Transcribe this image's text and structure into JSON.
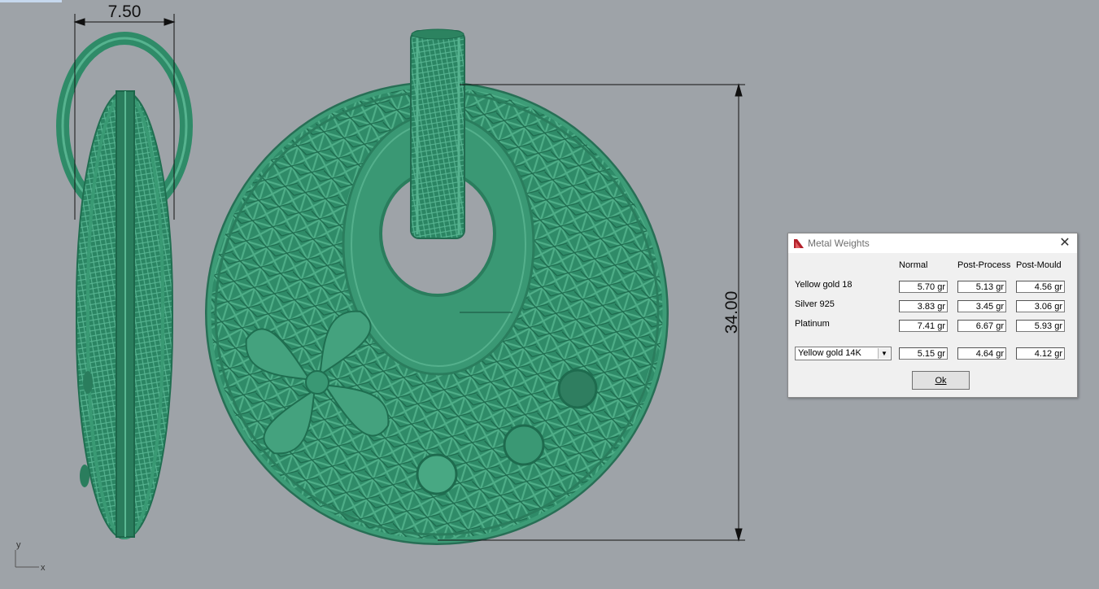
{
  "viewport": {
    "dimension_width": "7.50",
    "dimension_height": "34.00",
    "axis_x": "x",
    "axis_y": "y",
    "model_color": "#2e8a66",
    "background_color": "#9ea3a8"
  },
  "dialog": {
    "title": "Metal Weights",
    "close_label": "✕",
    "columns": [
      "Normal",
      "Post-Process",
      "Post-Mould"
    ],
    "rows": [
      {
        "label": "Yellow gold 18",
        "values": [
          "5.70 gr",
          "5.13 gr",
          "4.56 gr"
        ]
      },
      {
        "label": "Silver 925",
        "values": [
          "3.83 gr",
          "3.45 gr",
          "3.06 gr"
        ]
      },
      {
        "label": "Platinum",
        "values": [
          "7.41 gr",
          "6.67 gr",
          "5.93 gr"
        ]
      }
    ],
    "custom": {
      "selected": "Yellow gold 14K",
      "values": [
        "5.15 gr",
        "4.64 gr",
        "4.12 gr"
      ]
    },
    "ok_label": "Ok"
  }
}
